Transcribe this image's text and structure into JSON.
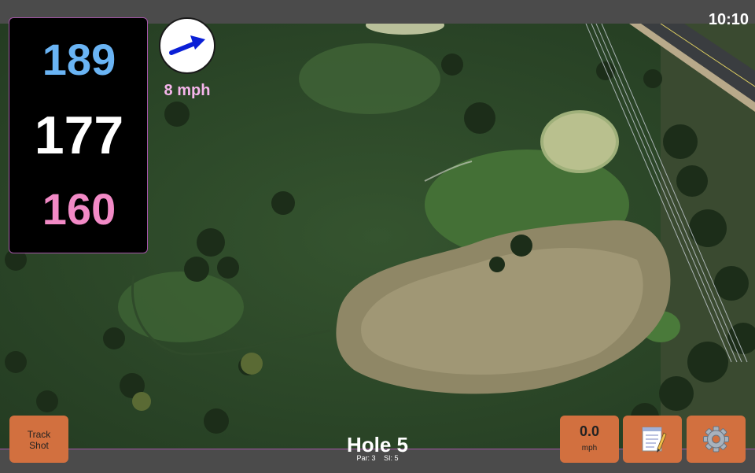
{
  "status_bar": {
    "time": "10:10"
  },
  "distances": {
    "back": "189",
    "middle": "177",
    "front": "160"
  },
  "wind": {
    "speed": "8 mph",
    "icon": "arrow-right-icon",
    "arrow_color": "#0a1fd6"
  },
  "buttons": {
    "track_shot_line1": "Track",
    "track_shot_line2": "Shot",
    "speed_value": "0.0",
    "speed_unit": "mph",
    "notes_icon": "notepad-icon",
    "settings_icon": "gear-icon"
  },
  "hole": {
    "title": "Hole 5",
    "par": "Par: 3",
    "si": "SI: 5"
  },
  "colors": {
    "back": "#6ab4f4",
    "middle": "#ffffff",
    "front": "#f28ac6",
    "button": "#d2703f",
    "border_accent": "#a455a8"
  }
}
